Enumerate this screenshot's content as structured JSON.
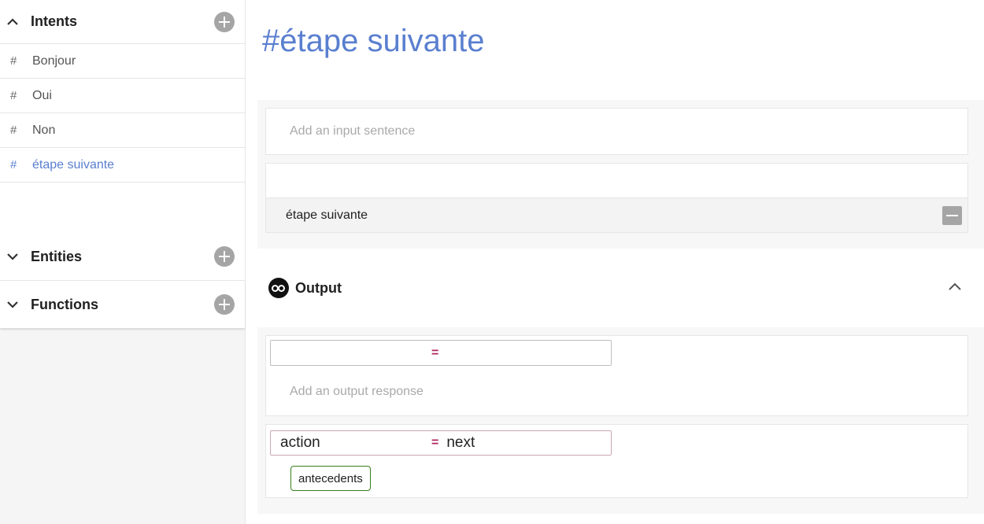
{
  "sidebar": {
    "intents": {
      "title": "Intents",
      "items": [
        {
          "hash": "#",
          "label": "Bonjour"
        },
        {
          "hash": "#",
          "label": "Oui"
        },
        {
          "hash": "#",
          "label": "Non"
        },
        {
          "hash": "#",
          "label": "étape suivante"
        }
      ]
    },
    "entities": {
      "title": "Entities"
    },
    "functions": {
      "title": "Functions"
    }
  },
  "main": {
    "title": "#étape suivante",
    "input_placeholder": "Add an input sentence",
    "sentences": [
      "étape suivante"
    ],
    "output": {
      "title": "Output",
      "context_row_1": {
        "key": "",
        "equals": "=",
        "value": ""
      },
      "response_placeholder": "Add an output response",
      "context_row_2": {
        "key": "action",
        "equals": "=",
        "value": "next"
      },
      "chip_label": "antecedents"
    }
  },
  "colors": {
    "accent": "#5a7fcf",
    "equals": "#b0235e",
    "chip_border": "#3a7d1c",
    "button_grey": "#a5a5a5"
  },
  "icons": {
    "intents_toggle": "chevron-up-icon",
    "entities_toggle": "chevron-down-icon",
    "functions_toggle": "chevron-down-icon",
    "add": "plus-circle-icon",
    "remove": "minus-square-icon",
    "output": "owl-icon",
    "output_collapse": "chevron-up-icon"
  }
}
